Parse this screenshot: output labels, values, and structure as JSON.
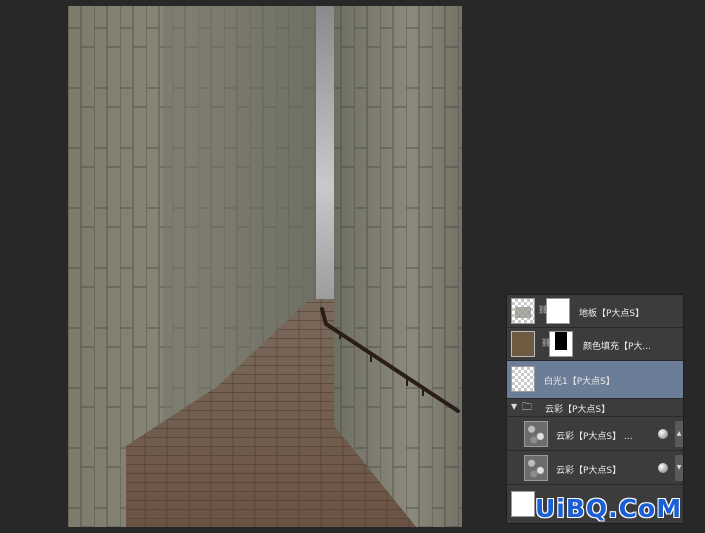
{
  "layers": [
    {
      "name": "地板【P大点S】",
      "thumb": "checker-stone",
      "mask": true,
      "selected": false
    },
    {
      "name": "颜色填充【P大...",
      "thumb": "color-fill",
      "mask": true,
      "selected": false
    },
    {
      "name": "白光1【P大点S】",
      "thumb": "checker",
      "mask": false,
      "selected": true
    },
    {
      "name": "云彩【P大点S】",
      "type": "group",
      "expanded": true
    },
    {
      "name": "云彩【P大点S】 ...",
      "thumb": "clouds",
      "fx": true
    },
    {
      "name": "云彩【P大点S】",
      "thumb": "clouds",
      "fx": true
    },
    {
      "name": "",
      "thumb": "white"
    }
  ],
  "watermark": "UiBQ.CoM",
  "colors": {
    "workspace": "#282828",
    "panel": "#3c3c3c",
    "selected_row": "#6b7d97",
    "color_fill": "#6f5b42",
    "watermark": "#1a5fd6"
  }
}
